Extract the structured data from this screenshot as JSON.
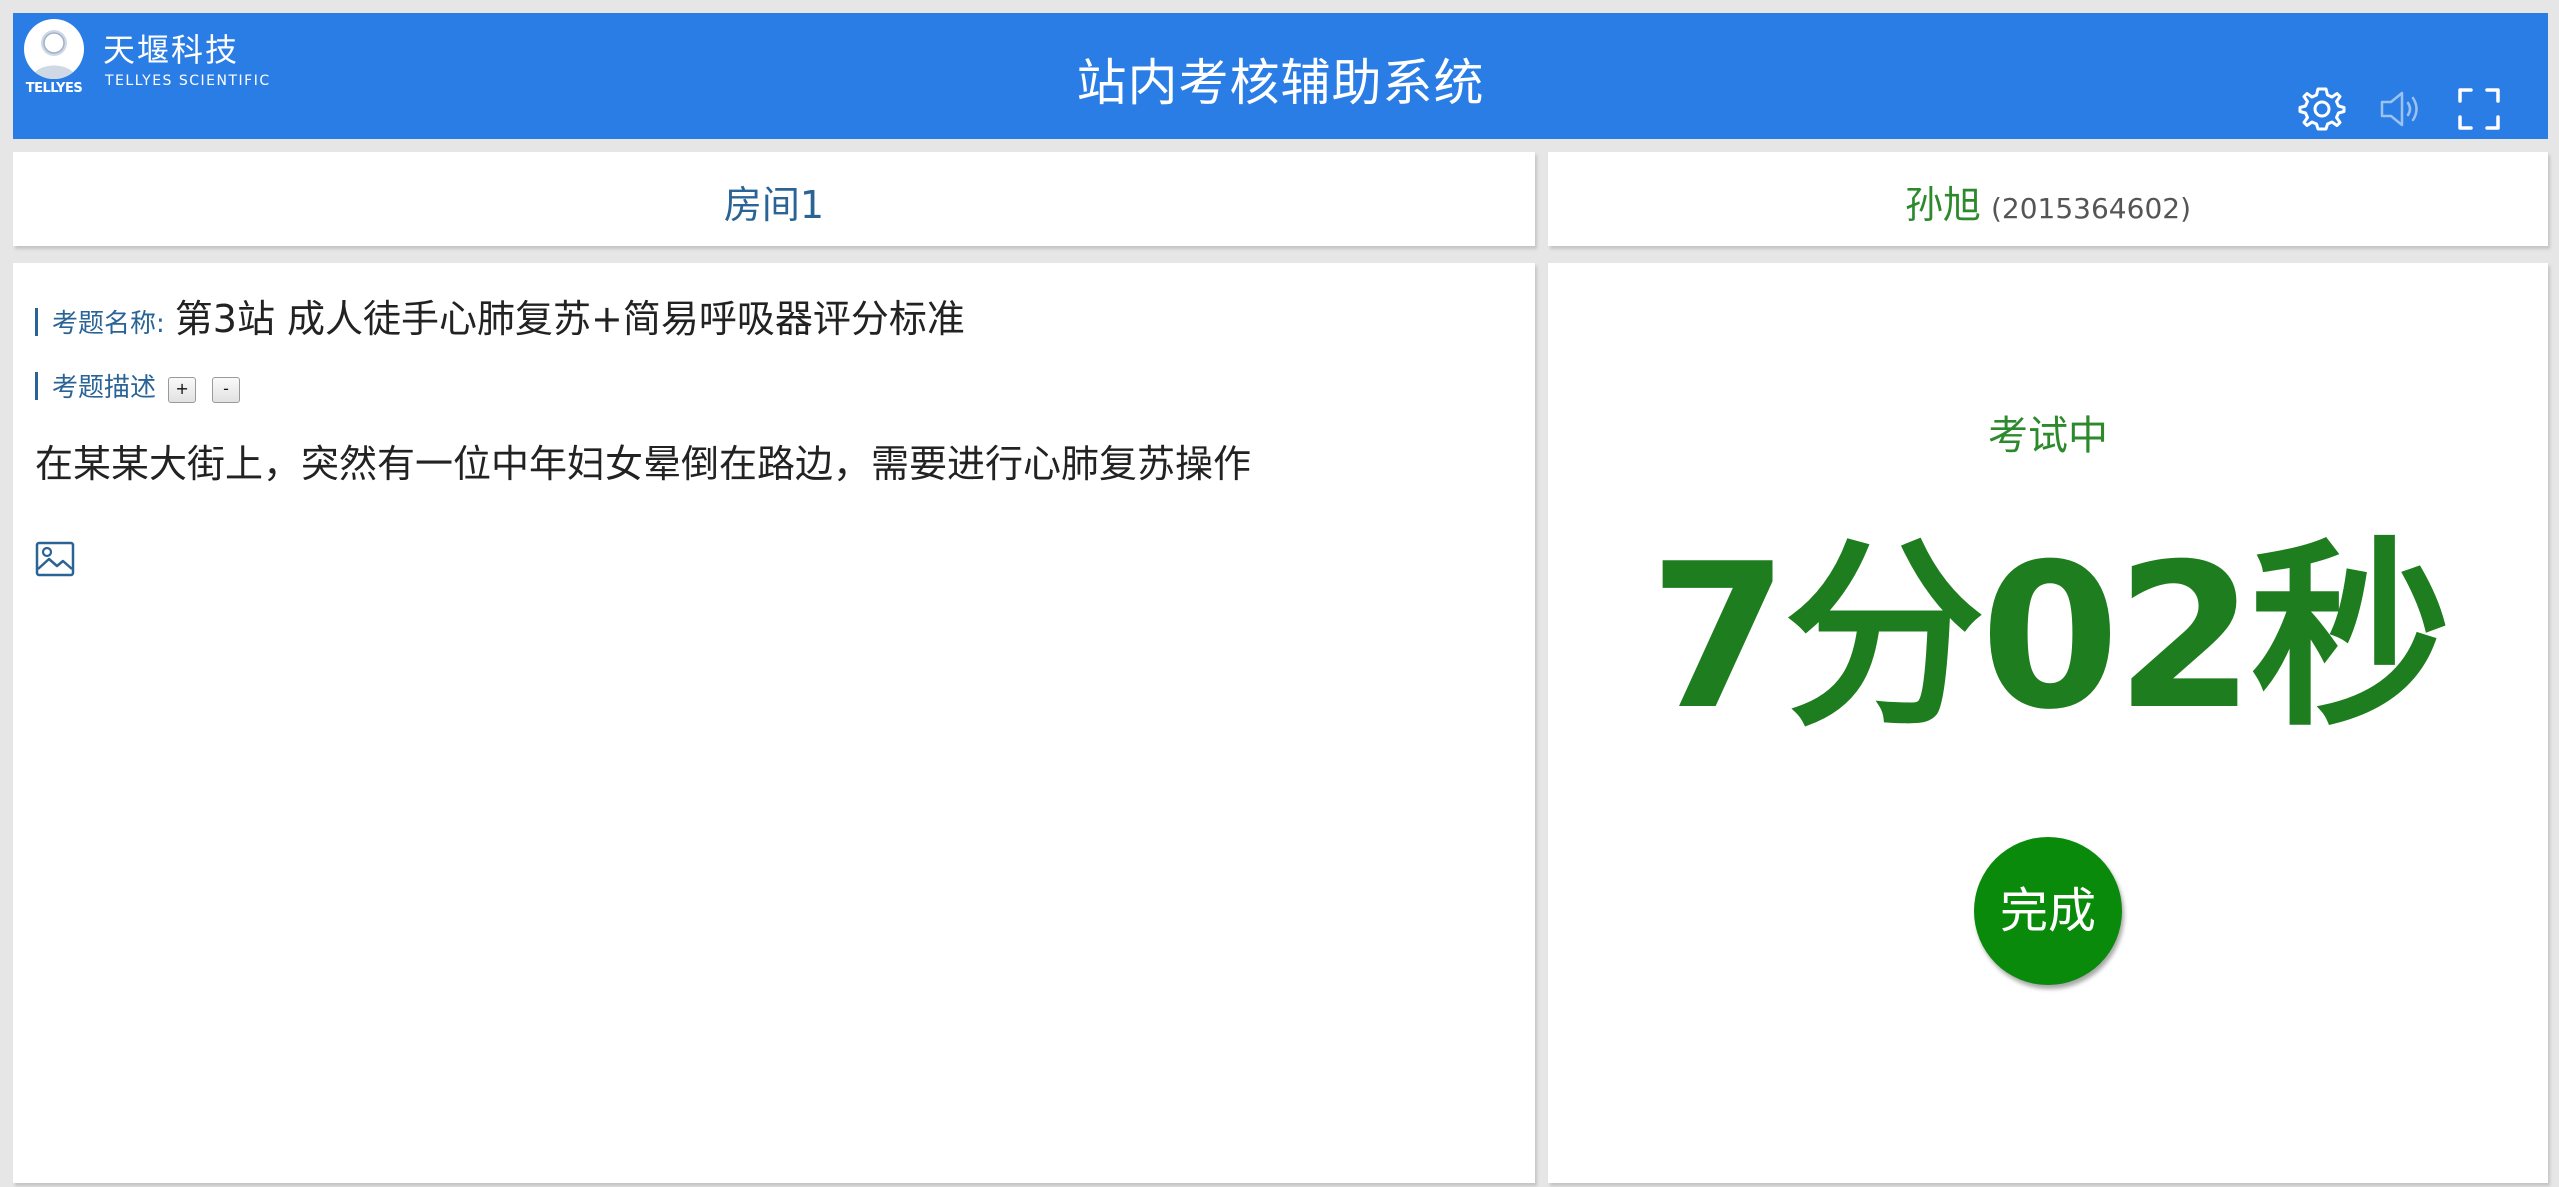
{
  "colors": {
    "header_bg": "#2b7de6",
    "page_bg": "#e6e6e6",
    "link_blue": "#2a6496",
    "status_green": "#2c8a2c",
    "timer_green": "#1e7d1e",
    "finish_button": "#0a8a0a"
  },
  "header": {
    "logo_badge_text": "TELLYES",
    "logo_cn": "天堰科技",
    "logo_en": "TELLYES SCIENTIFIC",
    "title": "站内考核辅助系统",
    "icons": [
      "gear-icon",
      "speaker-icon",
      "fullscreen-icon"
    ]
  },
  "room": {
    "title": "房间1"
  },
  "candidate": {
    "name": "孙旭",
    "id": "(2015364602)"
  },
  "question": {
    "name_label": "考题名称:",
    "name": "第3站 成人徒手心肺复苏+简易呼吸器评分标准",
    "desc_label": "考题描述",
    "expand_label": "+",
    "collapse_label": "-",
    "description": "在某某大街上，突然有一位中年妇女晕倒在路边，需要进行心肺复苏操作",
    "image_icon": "image-icon"
  },
  "exam": {
    "status": "考试中",
    "timer": "7分02秒",
    "finish_label": "完成"
  }
}
